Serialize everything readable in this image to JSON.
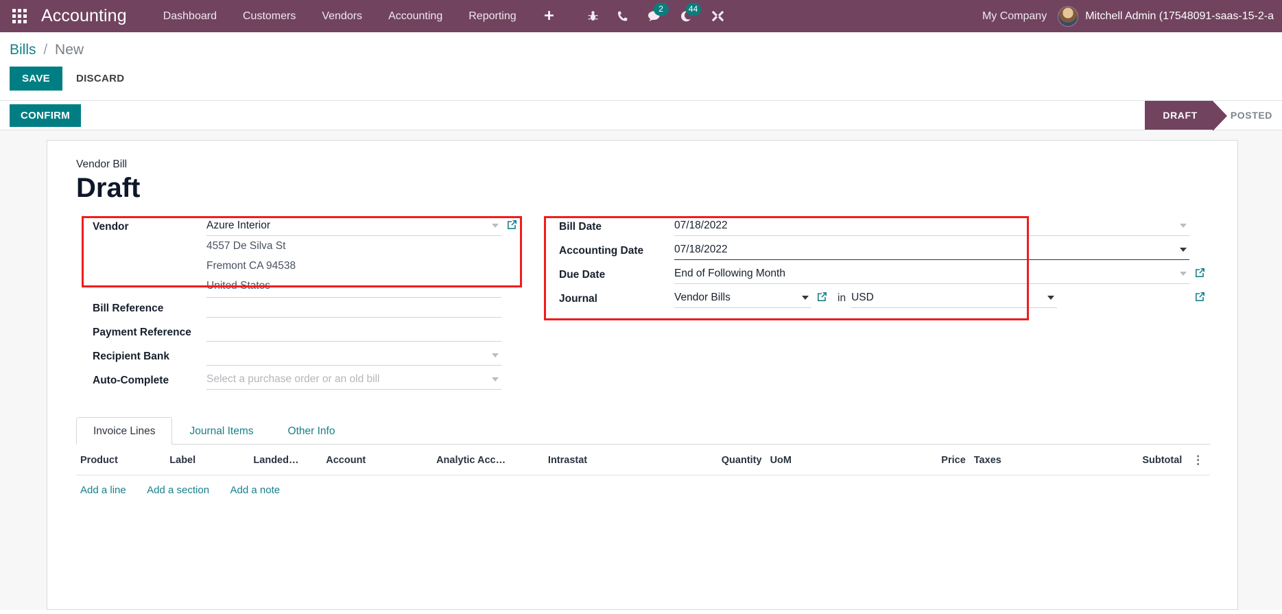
{
  "navbar": {
    "apps_icon": "apps-grid-icon",
    "brand": "Accounting",
    "menu": [
      {
        "label": "Dashboard"
      },
      {
        "label": "Customers"
      },
      {
        "label": "Vendors"
      },
      {
        "label": "Accounting"
      },
      {
        "label": "Reporting"
      }
    ],
    "plus_icon": "plus-icon",
    "icons": [
      {
        "name": "bug-icon",
        "badge": ""
      },
      {
        "name": "phone-icon",
        "badge": ""
      },
      {
        "name": "messages-icon",
        "badge": "2"
      },
      {
        "name": "activities-clock-icon",
        "badge": "44"
      },
      {
        "name": "tools-wrench-icon",
        "badge": ""
      }
    ],
    "company": "My Company",
    "user": "Mitchell Admin (17548091-saas-15-2-a",
    "avatar": "user-avatar",
    "bg_color": "#71435f",
    "badge_color": "#0d7c7c"
  },
  "breadcrumb": {
    "parent": "Bills",
    "separator": "/",
    "current": "New"
  },
  "actions": {
    "save_label": "SAVE",
    "discard_label": "DISCARD",
    "confirm_label": "CONFIRM",
    "accent_color": "#017e84"
  },
  "statusbar": {
    "stages": [
      {
        "label": "DRAFT",
        "active": true
      },
      {
        "label": "POSTED",
        "active": false
      }
    ],
    "active_color": "#71435f"
  },
  "document": {
    "type_label": "Vendor Bill",
    "title": "Draft"
  },
  "highlight_color": "#f01c1c",
  "form": {
    "left": [
      {
        "label": "Vendor",
        "value": "Azure Interior",
        "placeholder": "",
        "has_caret": true,
        "has_external_link": true,
        "highlighted": true
      },
      {
        "label": "Bill Reference",
        "value": "",
        "placeholder": "",
        "has_caret": false,
        "has_external_link": false,
        "highlighted": false
      },
      {
        "label": "Payment Reference",
        "value": "",
        "placeholder": "",
        "has_caret": false,
        "has_external_link": false,
        "highlighted": false
      },
      {
        "label": "Recipient Bank",
        "value": "",
        "placeholder": "",
        "has_caret": true,
        "has_external_link": false,
        "highlighted": false
      },
      {
        "label": "Auto-Complete",
        "value": "",
        "placeholder": "Select a purchase order or an old bill",
        "has_caret": true,
        "has_external_link": false,
        "highlighted": false
      }
    ],
    "vendor_address": [
      "4557 De Silva St",
      "Fremont CA 94538",
      "United States"
    ],
    "right": [
      {
        "label": "Bill Date",
        "value": "07/18/2022",
        "has_caret": true,
        "has_external_link": false
      },
      {
        "label": "Accounting Date",
        "value": "07/18/2022",
        "has_caret": true,
        "has_external_link": false
      },
      {
        "label": "Due Date",
        "value": "End of Following Month",
        "has_caret": true,
        "has_external_link": true
      }
    ],
    "journal": {
      "label": "Journal",
      "value": "Vendor Bills",
      "in_word": "in",
      "currency": "USD"
    }
  },
  "tabs": [
    {
      "label": "Invoice Lines",
      "active": true
    },
    {
      "label": "Journal Items",
      "active": false
    },
    {
      "label": "Other Info",
      "active": false
    }
  ],
  "lines_table": {
    "columns": [
      {
        "label": "Product",
        "align": "left"
      },
      {
        "label": "Label",
        "align": "left"
      },
      {
        "label": "Landed…",
        "align": "left"
      },
      {
        "label": "Account",
        "align": "left"
      },
      {
        "label": "Analytic Acc…",
        "align": "left"
      },
      {
        "label": "Intrastat",
        "align": "left"
      },
      {
        "label": "Quantity",
        "align": "right"
      },
      {
        "label": "UoM",
        "align": "left"
      },
      {
        "label": "Price",
        "align": "right"
      },
      {
        "label": "Taxes",
        "align": "left"
      },
      {
        "label": "Subtotal",
        "align": "right"
      }
    ],
    "options_icon": "vertical-dots-icon",
    "add_links": [
      {
        "label": "Add a line"
      },
      {
        "label": "Add a section"
      },
      {
        "label": "Add a note"
      }
    ],
    "rows": []
  }
}
